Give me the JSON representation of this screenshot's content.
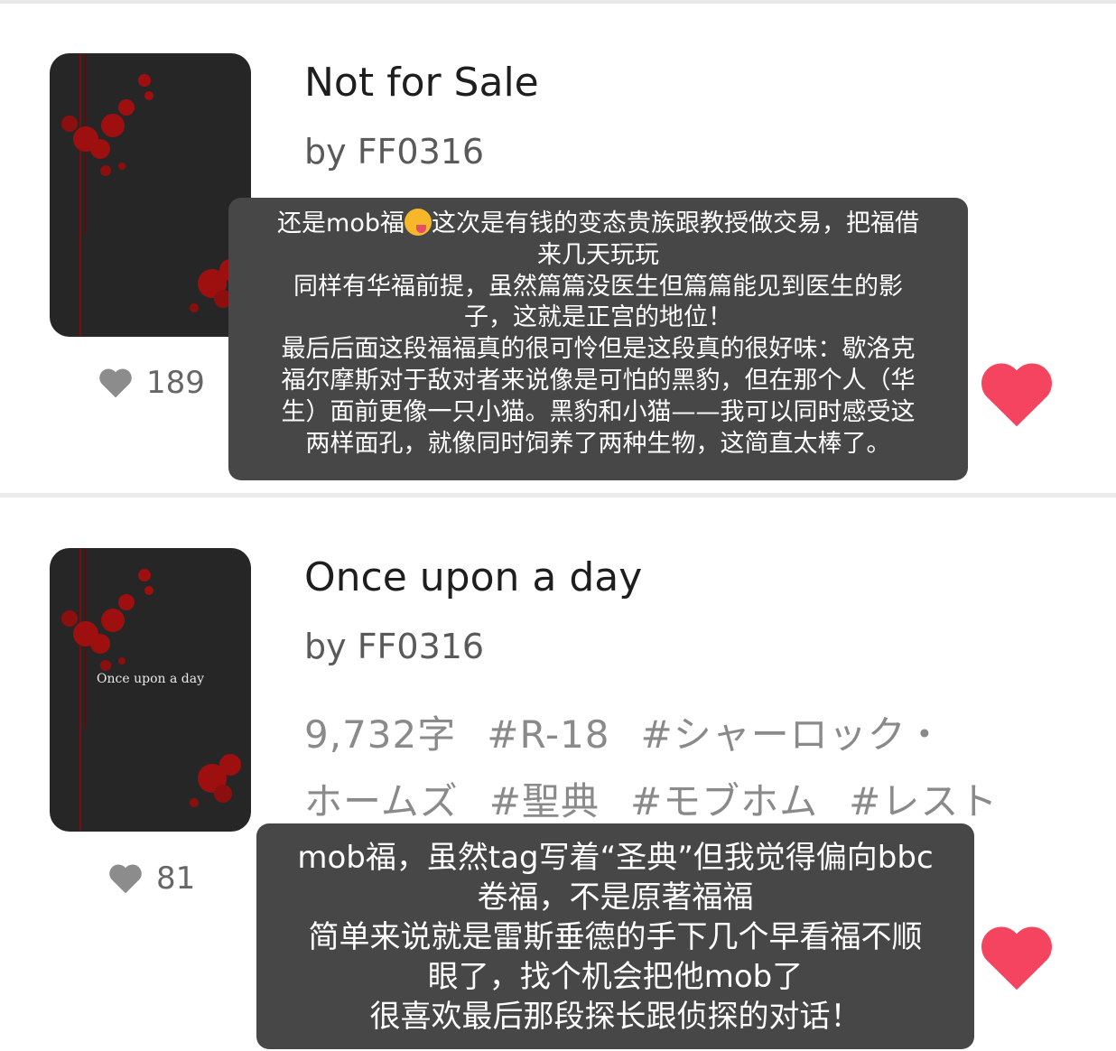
{
  "works": [
    {
      "title": "Not for Sale",
      "author": "by FF0316",
      "likes": "189",
      "note": {
        "line1a": "还是mob福",
        "emoji": "smiling-tongue-emoji",
        "line1b": "这次是有钱的变态贵族跟教授做交易，把福借",
        "line2": "来几天玩玩",
        "line3": "同样有华福前提，虽然篇篇没医生但篇篇能见到医生的影",
        "line4": "子，这就是正宫的地位！",
        "line5": "最后后面这段福福真的很可怜但是这段真的很好味：歇洛克",
        "line6": "福尔摩斯对于敌对者来说像是可怕的黑豹，但在那个人（华",
        "line7": "生）面前更像一只小猫。黑豹和小猫——我可以同时感受这",
        "line8": "两样面孔，就像同时饲养了两种生物，这简直太棒了。"
      }
    },
    {
      "title": "Once upon a day",
      "author": "by FF0316",
      "cover_text": "Once upon a day",
      "likes": "81",
      "word_count": "9,732字",
      "tags": [
        "#R-18",
        "#シャーロック・",
        "ホームズ",
        "#聖典",
        "#モブホム",
        "#レスト"
      ],
      "note": {
        "line1": "mob福，虽然tag写着“圣典”但我觉得偏向bbc",
        "line2": "卷福，不是原著福福",
        "line3": "简单来说就是雷斯垂德的手下几个早看福不顺",
        "line4": "眼了，找个机会把他mob了",
        "line5": "很喜欢最后那段探长跟侦探的对话！"
      }
    }
  ],
  "colors": {
    "favorite_heart": "#f5445f",
    "like_icon": "#8c8c8c",
    "note_bg": "#474747",
    "cover_bg": "#262626",
    "cover_splatter": "#9e1010"
  }
}
